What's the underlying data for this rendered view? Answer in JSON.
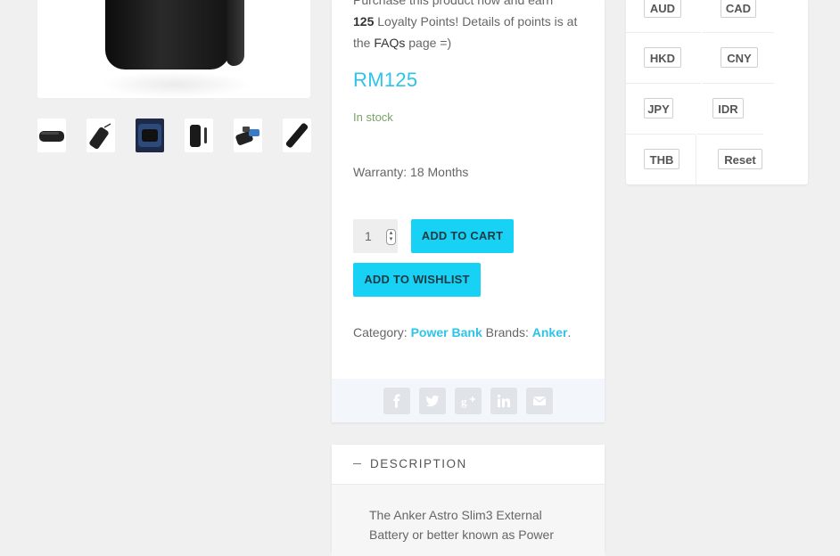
{
  "gallery": {
    "thumbnails": [
      {
        "icon": "power-bank-flat-thumb"
      },
      {
        "icon": "power-bank-cable-thumb"
      },
      {
        "icon": "power-bank-pouch-thumb"
      },
      {
        "icon": "power-bank-standing-thumb"
      },
      {
        "icon": "power-bank-charging-thumb"
      },
      {
        "icon": "power-bank-angled-thumb"
      }
    ]
  },
  "product": {
    "loyalty_intro": "Purchase this product now and earn",
    "loyalty_points": "125",
    "loyalty_suffix": "Loyalty Points! Details of points is at the",
    "faqs_link": "FAQs",
    "loyalty_end": "page =)",
    "price": "RM125",
    "stock": "In stock",
    "warranty": "Warranty: 18 Months",
    "quantity": "1",
    "add_to_cart": "ADD TO CART",
    "add_to_wishlist": "ADD TO WISHLIST",
    "category_label": "Category:",
    "category": "Power Bank",
    "brands_label": "Brands:",
    "brand": "Anker",
    "period": "."
  },
  "share": {
    "icons": [
      "facebook-icon",
      "twitter-icon",
      "google-plus-icon",
      "linkedin-icon",
      "email-icon"
    ]
  },
  "description": {
    "title": "DESCRIPTION",
    "text": "The Anker Astro Slim3 External Battery or better known as Power"
  },
  "currency": {
    "buttons": [
      "AUD",
      "CAD",
      "HKD",
      "CNY",
      "JPY",
      "IDR",
      "THB",
      "Reset"
    ]
  },
  "colors": {
    "accent": "#2ec4e8",
    "button": "#18d2f5",
    "in_stock": "#77a464"
  }
}
